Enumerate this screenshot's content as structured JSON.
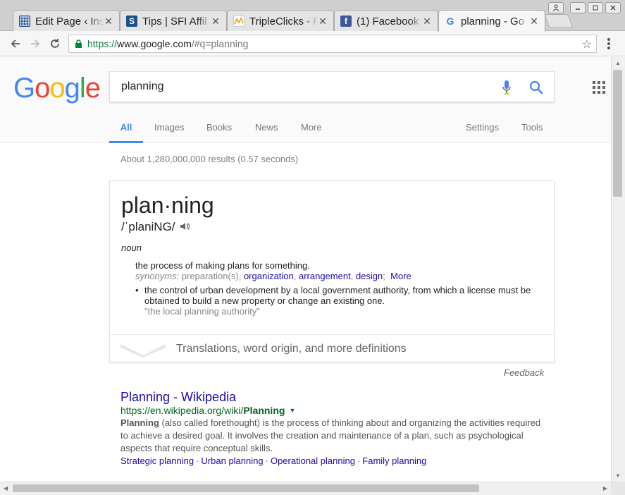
{
  "browser": {
    "tabs": [
      {
        "label": "Edit Page ‹ Ins",
        "icon": "grid-icon",
        "color": "#1e4d8c"
      },
      {
        "label": "Tips | SFI Affil",
        "icon": "sfi-icon",
        "color": "#1b4f8a"
      },
      {
        "label": "TripleClicks - F",
        "icon": "tripleclicks-icon",
        "color": "#e8a013"
      },
      {
        "label": "(1) Facebook",
        "icon": "facebook-icon",
        "color": "#3b5998"
      },
      {
        "label": "planning - Go",
        "icon": "google-icon",
        "color": "#4285f4",
        "active": true
      }
    ],
    "url": {
      "scheme": "https://",
      "host": "www.google.com",
      "rest": "/#q=planning"
    }
  },
  "google": {
    "logo": [
      "G",
      "o",
      "o",
      "g",
      "l",
      "e"
    ],
    "logo_colors": [
      "#4285f4",
      "#ea4335",
      "#fbbc05",
      "#4285f4",
      "#34a853",
      "#ea4335"
    ],
    "query": "planning",
    "tabs": {
      "all": "All",
      "images": "Images",
      "books": "Books",
      "news": "News",
      "more": "More",
      "settings": "Settings",
      "tools": "Tools"
    },
    "stats": "About 1,280,000,000 results (0.57 seconds)"
  },
  "dictionary": {
    "word": "plan·ning",
    "phonetic": "/ˈplaniNG/",
    "pos": "noun",
    "def1": "the process of making plans for something.",
    "syn_label": "synonyms:",
    "syn_plain": "preparation(s),",
    "synonyms": [
      "organization",
      "arrangement",
      "design"
    ],
    "syn_more": "More",
    "def2": "the control of urban development by a local government authority, from which a license must be obtained to build a new property or change an existing one.",
    "example": "\"the local planning authority\"",
    "footer": "Translations, word origin, and more definitions",
    "feedback": "Feedback"
  },
  "result": {
    "title": "Planning - Wikipedia",
    "url_prefix": "https://en.wikipedia.org/wiki/",
    "url_bold": "Planning",
    "snippet_bold": "Planning",
    "snippet": " (also called forethought) is the process of thinking about and organizing the activities required to achieve a desired goal. It involves the creation and maintenance of a plan, such as psychological aspects that require conceptual skills.",
    "sitelinks": [
      "Strategic planning",
      "Urban planning",
      "Operational planning",
      "Family planning"
    ]
  }
}
